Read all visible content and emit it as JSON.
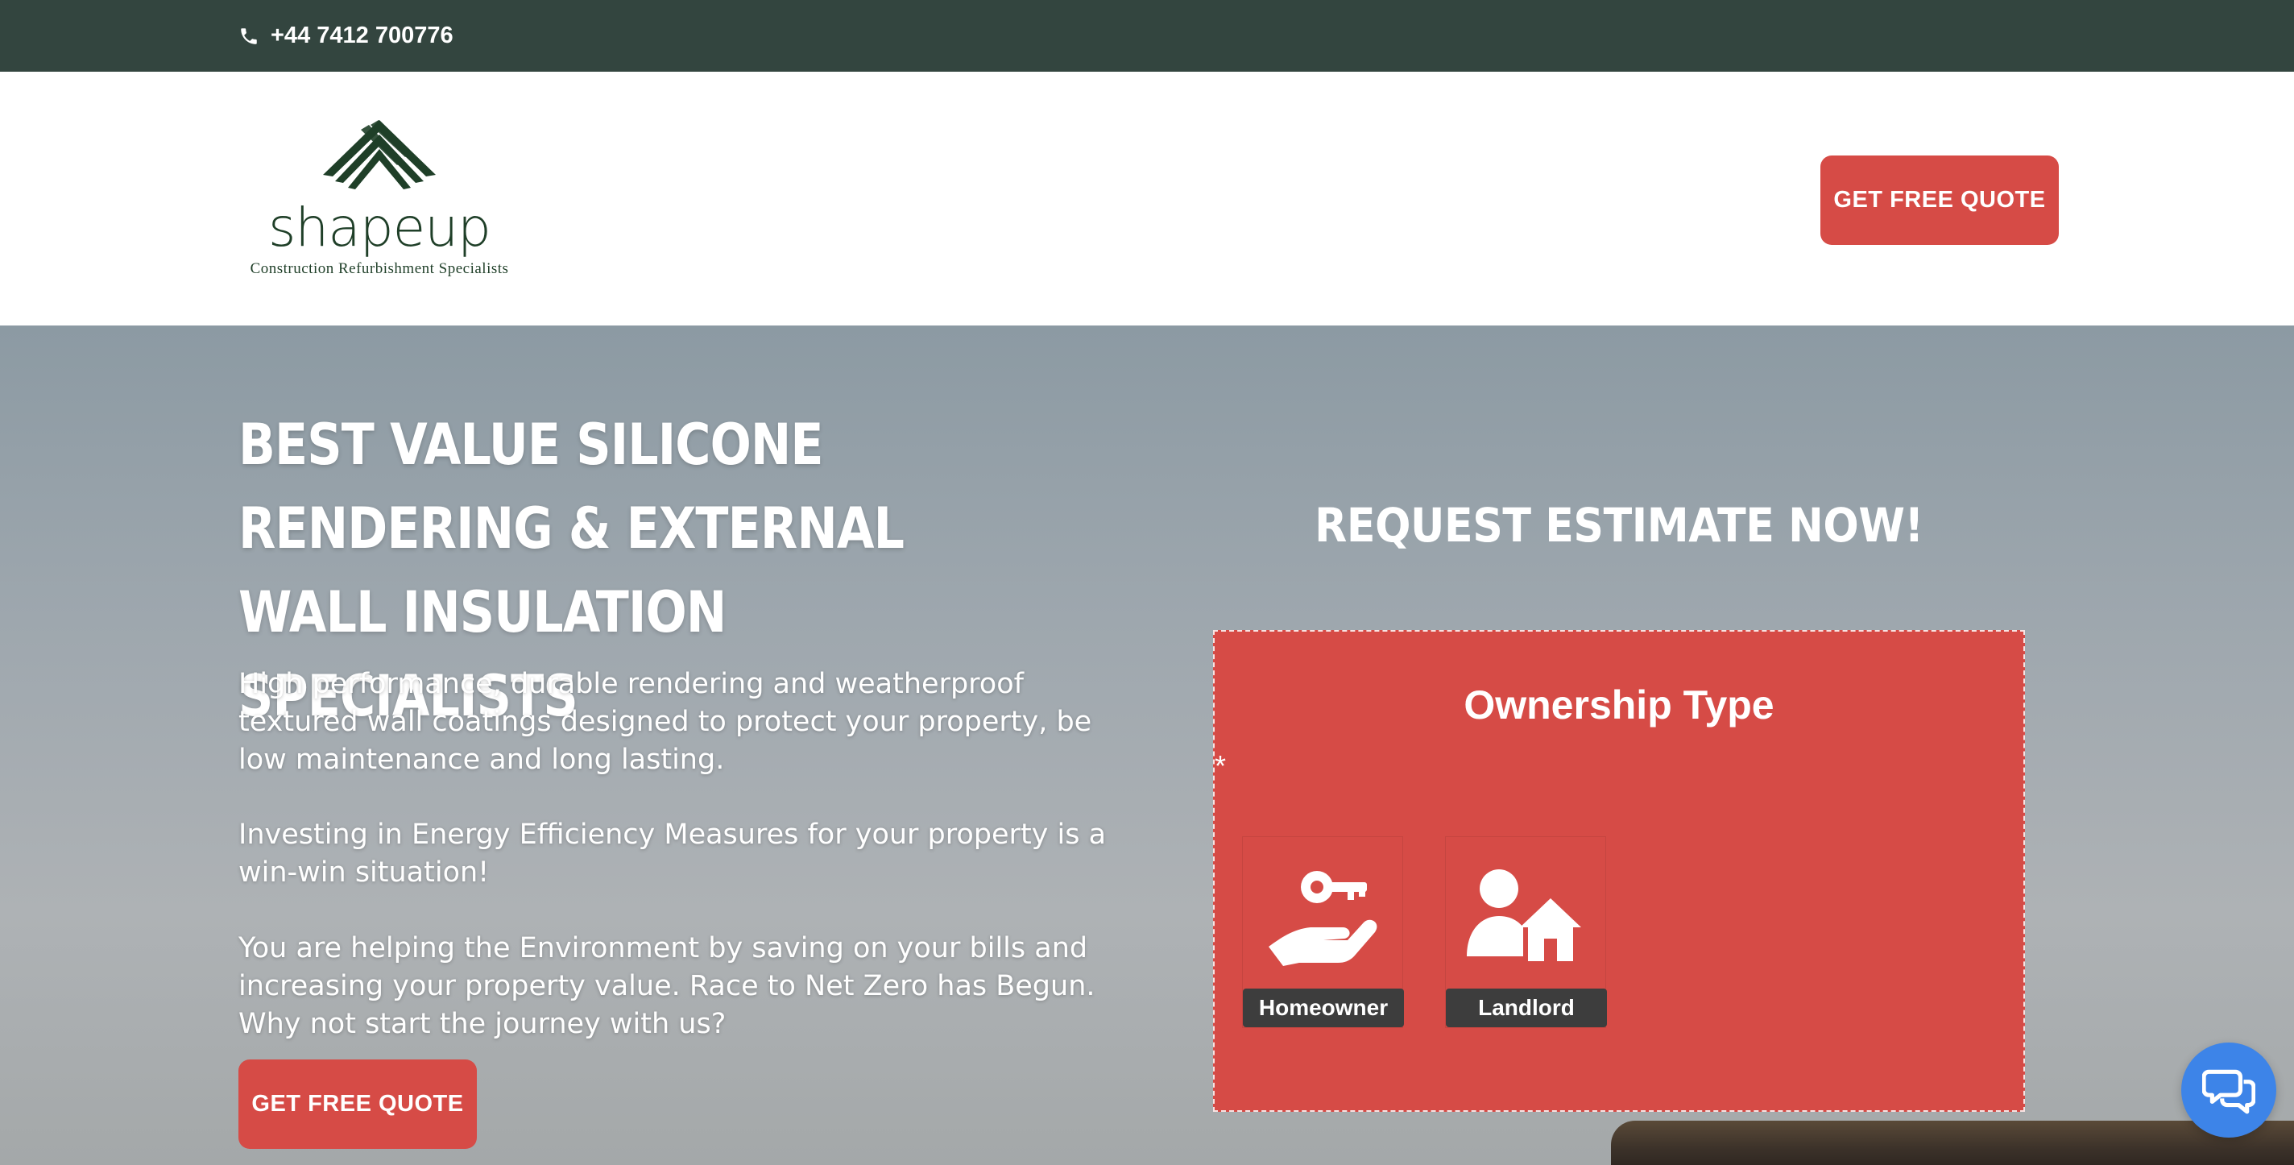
{
  "topbar": {
    "phone": "+44 7412 700776",
    "phone_icon": "phone-icon"
  },
  "header": {
    "logo_word": "shapeup",
    "logo_tagline": "Construction Refurbishment Specialists",
    "cta": "GET FREE QUOTE"
  },
  "hero": {
    "title": "BEST VALUE SILICONE RENDERING & EXTERNAL WALL INSULATION SPECIALISTS",
    "paragraphs": [
      "High performance, durable rendering and weatherproof textured wall coatings designed to protect your property, be low maintenance and long lasting.",
      "Investing in Energy Efficiency Measures for your property is a win-win situation!",
      "You are helping the Environment by saving on your bills and increasing your property value. Race to Net Zero has Begun. Why not start the journey with us?"
    ],
    "cta": "GET FREE QUOTE"
  },
  "estimate": {
    "title": "REQUEST ESTIMATE NOW!",
    "question": "Ownership Type",
    "required_mark": "*",
    "options": [
      {
        "label": "Homeowner",
        "icon": "hand-key-icon"
      },
      {
        "label": "Landlord",
        "icon": "person-house-icon"
      }
    ]
  },
  "colors": {
    "topbar": "#33453f",
    "accent": "#d64b46",
    "option_label_bg": "#3d3d3d",
    "chat": "#3d84e8",
    "logo": "#1f3f28"
  },
  "chat": {
    "icon": "chat-bubbles-icon"
  }
}
